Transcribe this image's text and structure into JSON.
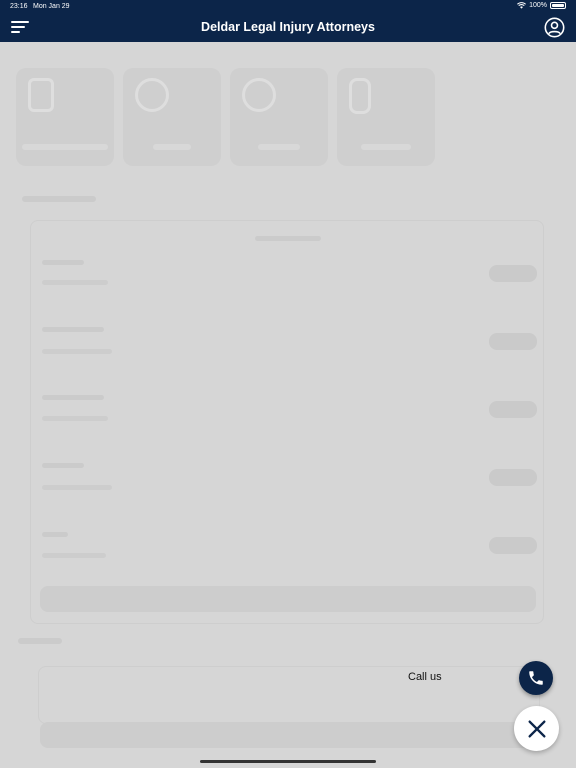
{
  "status_bar": {
    "time": "23:16",
    "date": "Mon Jan 29",
    "battery": "100%"
  },
  "nav": {
    "title": "Deldar Legal Injury Attorneys",
    "menu_icon": "menu-icon",
    "profile_icon": "account-circle-icon"
  },
  "fab": {
    "call_label": "Call us",
    "call_icon": "phone-icon",
    "close_icon": "close-icon"
  },
  "colors": {
    "brand": "#0c2549",
    "overlay_bg": "#d6d6d6"
  }
}
